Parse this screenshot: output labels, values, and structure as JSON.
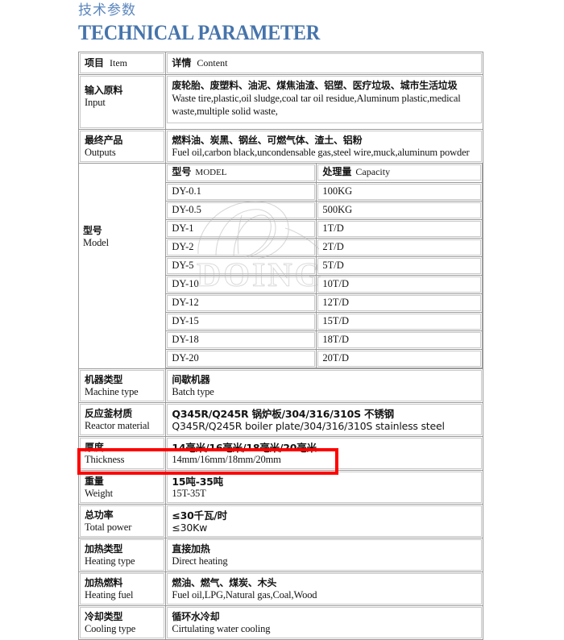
{
  "header": {
    "title_cn": "技术参数",
    "title_en": "TECHNICAL PARAMETER",
    "title_color": "#4674ab",
    "title_cn_color": "#5b86bd"
  },
  "table": {
    "columns": [
      {
        "cn": "项目",
        "en": "Item"
      },
      {
        "cn": "详情",
        "en": "Content"
      }
    ],
    "rows": [
      {
        "item_cn": "输入原料",
        "item_en": "Input",
        "content_cn": "废轮胎、废塑料、油泥、煤焦油渣、铝塑、医疗垃圾、城市生活垃圾",
        "content_en": "Waste tire,plastic,oil sludge,coal tar oil residue,Aluminum plastic,medical waste,multiple solid waste,"
      },
      {
        "item_cn": "最终产品",
        "item_en": "Outputs",
        "content_cn": "燃料油、炭黑、钢丝、可燃气体、渣土、铝粉",
        "content_en": "Fuel oil,carbon black,uncondensable gas,steel wire,muck,aluminum powder"
      },
      {
        "item_cn": "型号",
        "item_en": "Model",
        "content_cn": "",
        "content_en": ""
      },
      {
        "item_cn": "机器类型",
        "item_en": "Machine type",
        "content_cn": "间歇机器",
        "content_en": "Batch type"
      },
      {
        "item_cn": "反应釜材质",
        "item_en": "Reactor material",
        "content_cn": "Q345R/Q245R 锅炉板/304/316/310S 不锈钢",
        "content_en": "Q345R/Q245R boiler plate/304/316/310S stainless steel"
      },
      {
        "item_cn": "厚度",
        "item_en": "Thickness",
        "content_cn": "14毫米/16毫米/18毫米/20毫米",
        "content_en": "14mm/16mm/18mm/20mm"
      },
      {
        "item_cn": "重量",
        "item_en": "Weight",
        "content_cn": "15吨-35吨",
        "content_en": "15T-35T"
      },
      {
        "item_cn": "总功率",
        "item_en": "Total power",
        "content_cn": "≤30千瓦/时",
        "content_en": "≤30Kw"
      },
      {
        "item_cn": "加热类型",
        "item_en": "Heating type",
        "content_cn": "直接加热",
        "content_en": "Direct heating"
      },
      {
        "item_cn": "加热燃料",
        "item_en": "Heating fuel",
        "content_cn": "燃油、燃气、煤炭、木头",
        "content_en": "Fuel oil,LPG,Natural gas,Coal,Wood",
        "highlighted": true
      },
      {
        "item_cn": "冷却类型",
        "item_en": "Cooling type",
        "content_cn": "循环水冷却",
        "content_en": "Cirtulating water cooling"
      }
    ]
  },
  "model_table": {
    "header": {
      "model_cn": "型号",
      "model_en": "MODEL",
      "capacity_cn": "处理量",
      "capacity_en": "Capacity"
    },
    "rows": [
      {
        "model": "DY-0.1",
        "capacity": "100KG"
      },
      {
        "model": "DY-0.5",
        "capacity": "500KG"
      },
      {
        "model": "DY-1",
        "capacity": "1T/D"
      },
      {
        "model": "DY-2",
        "capacity": "2T/D"
      },
      {
        "model": "DY-5",
        "capacity": "5T/D"
      },
      {
        "model": "DY-10",
        "capacity": "10T/D"
      },
      {
        "model": "DY-12",
        "capacity": "12T/D"
      },
      {
        "model": "DY-15",
        "capacity": "15T/D"
      },
      {
        "model": "DY-18",
        "capacity": "18T/D"
      },
      {
        "model": "DY-20",
        "capacity": "20T/D"
      }
    ]
  },
  "highlight": {
    "color": "#ff0000",
    "target_row": "加热燃料 / Heating fuel"
  },
  "watermark": {
    "text": "DOING"
  }
}
